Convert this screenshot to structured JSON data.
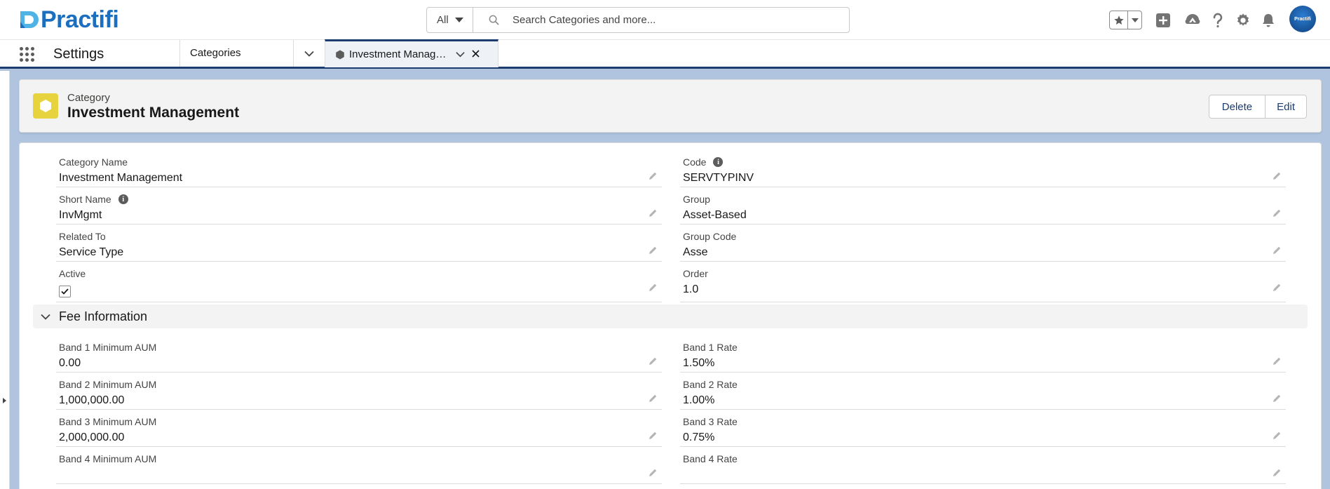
{
  "header": {
    "logo_text": "Practifi",
    "search_scope": "All",
    "search_placeholder": "Search Categories and more...",
    "avatar_text": "Practifi"
  },
  "nav": {
    "app_name": "Settings",
    "object_item": "Categories",
    "tab_label": "Investment Management"
  },
  "record": {
    "type": "Category",
    "title": "Investment Management",
    "delete_label": "Delete",
    "edit_label": "Edit",
    "icon_color": "#e6d33d"
  },
  "fields": {
    "category_name": {
      "label": "Category Name",
      "value": "Investment Management"
    },
    "code": {
      "label": "Code",
      "value": "SERVTYPINV"
    },
    "short_name": {
      "label": "Short Name",
      "value": "InvMgmt"
    },
    "group": {
      "label": "Group",
      "value": "Asset-Based"
    },
    "related_to": {
      "label": "Related To",
      "value": "Service Type"
    },
    "group_code": {
      "label": "Group Code",
      "value": "Asse"
    },
    "active": {
      "label": "Active",
      "checked": true
    },
    "order": {
      "label": "Order",
      "value": "1.0"
    }
  },
  "fee_section": {
    "title": "Fee Information",
    "band1_min": {
      "label": "Band 1 Minimum AUM",
      "value": "0.00"
    },
    "band1_rate": {
      "label": "Band 1 Rate",
      "value": "1.50%"
    },
    "band2_min": {
      "label": "Band 2 Minimum AUM",
      "value": "1,000,000.00"
    },
    "band2_rate": {
      "label": "Band 2 Rate",
      "value": "1.00%"
    },
    "band3_min": {
      "label": "Band 3 Minimum AUM",
      "value": "2,000,000.00"
    },
    "band3_rate": {
      "label": "Band 3 Rate",
      "value": "0.75%"
    },
    "band4_min": {
      "label": "Band 4 Minimum AUM",
      "value": ""
    },
    "band4_rate": {
      "label": "Band 4 Rate",
      "value": ""
    }
  },
  "colors": {
    "brand": "#1b6fbe",
    "nav_accent": "#1b3c6e",
    "background": "#b0c4df"
  }
}
